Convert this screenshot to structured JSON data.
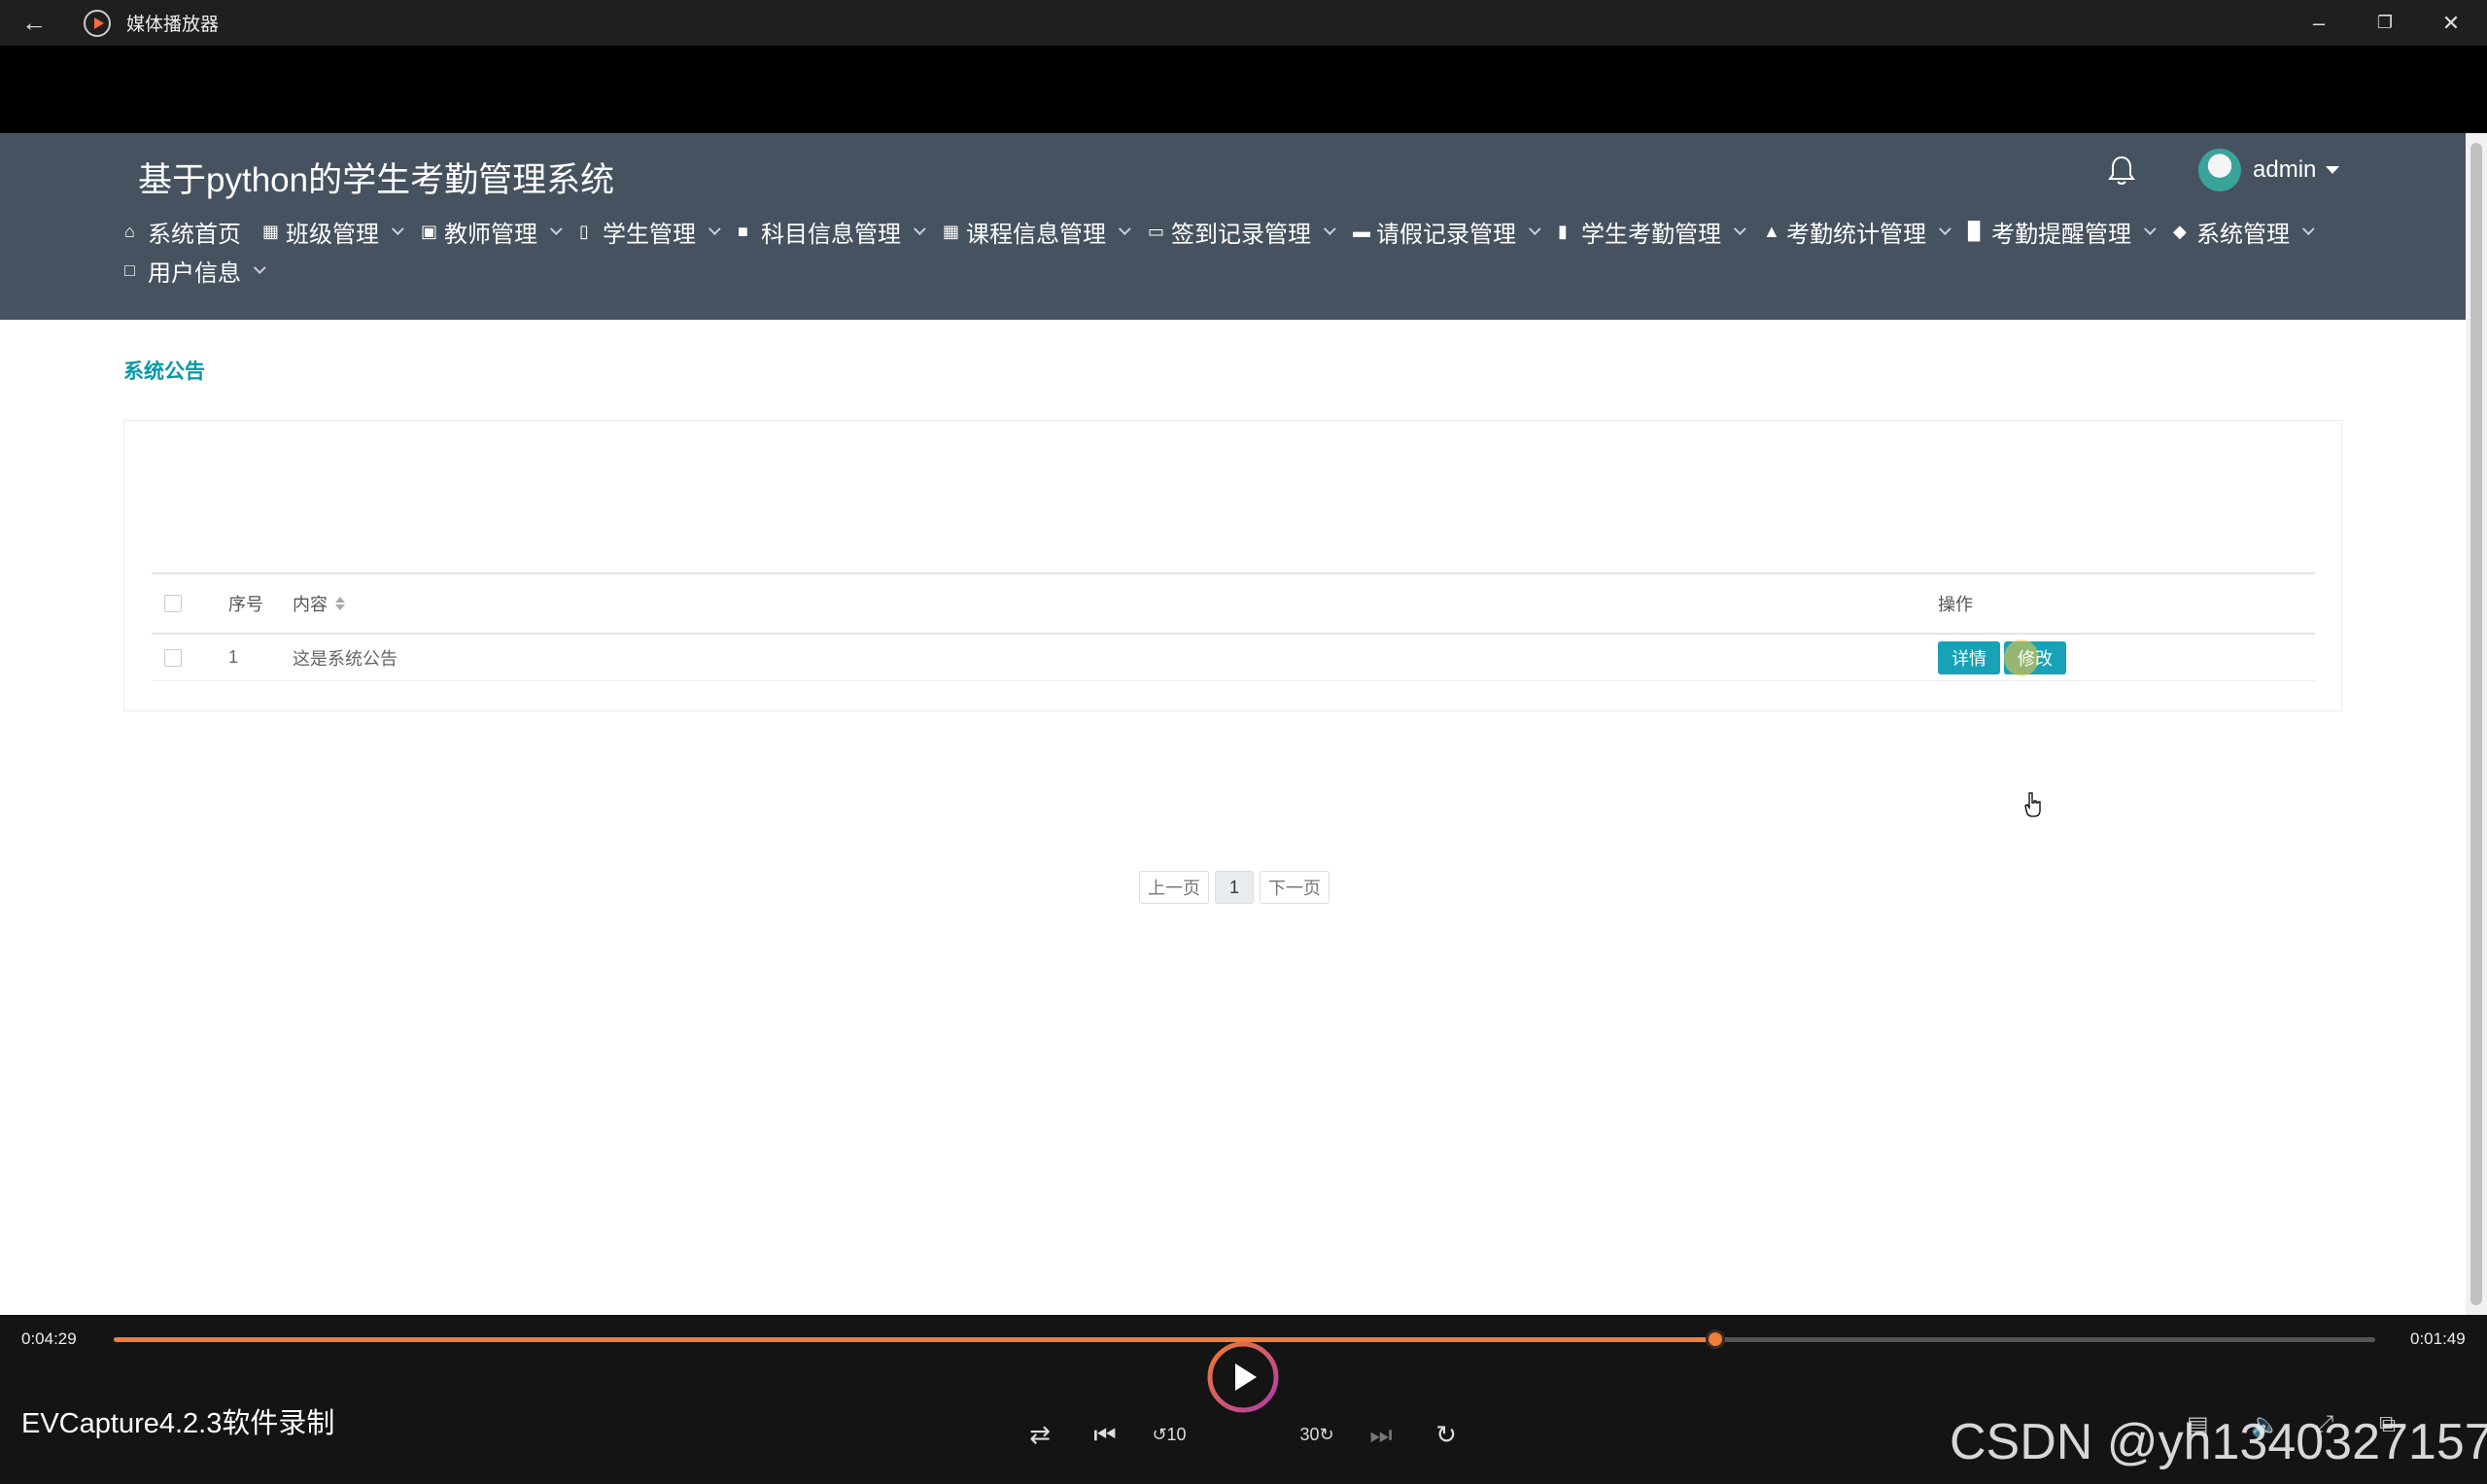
{
  "player": {
    "title": "媒体播放器",
    "current_time": "0:04:29",
    "remaining_time": "0:01:49",
    "progress": 0.708,
    "capture_label": "EVCapture4.2.3软件录制",
    "watermark": "CSDN @yh1340327157"
  },
  "site": {
    "title": "基于python的学生考勤管理系统",
    "username": "admin"
  },
  "nav": [
    {
      "label": "系统首页",
      "icon": "home-icon",
      "dropdown": false
    },
    {
      "label": "班级管理",
      "icon": "grid-icon",
      "dropdown": true
    },
    {
      "label": "教师管理",
      "icon": "briefcase-icon",
      "dropdown": true
    },
    {
      "label": "学生管理",
      "icon": "clipboard-icon",
      "dropdown": true
    },
    {
      "label": "科目信息管理",
      "icon": "stamp-icon",
      "dropdown": true
    },
    {
      "label": "课程信息管理",
      "icon": "grid-icon",
      "dropdown": true
    },
    {
      "label": "签到记录管理",
      "icon": "comment-icon",
      "dropdown": true
    },
    {
      "label": "请假记录管理",
      "icon": "monitor-icon",
      "dropdown": true
    },
    {
      "label": "学生考勤管理",
      "icon": "book-icon",
      "dropdown": true
    },
    {
      "label": "考勤统计管理",
      "icon": "car-icon",
      "dropdown": true
    },
    {
      "label": "考勤提醒管理",
      "icon": "bar-chart-icon",
      "dropdown": true
    },
    {
      "label": "系统管理",
      "icon": "shield-icon",
      "dropdown": true
    },
    {
      "label": "用户信息",
      "icon": "id-card-icon",
      "dropdown": true
    }
  ],
  "breadcrumb": "系统公告",
  "table": {
    "headers": {
      "index": "序号",
      "content": "内容",
      "ops": "操作"
    },
    "rows": [
      {
        "index": "1",
        "content": "这是系统公告",
        "detail_label": "详情",
        "edit_label": "修改"
      }
    ]
  },
  "pager": {
    "prev": "上一页",
    "current": "1",
    "next": "下一页"
  },
  "colors": {
    "header_bg": "#475260",
    "accent": "#17a2b8",
    "progress": "#ef7d3d"
  }
}
